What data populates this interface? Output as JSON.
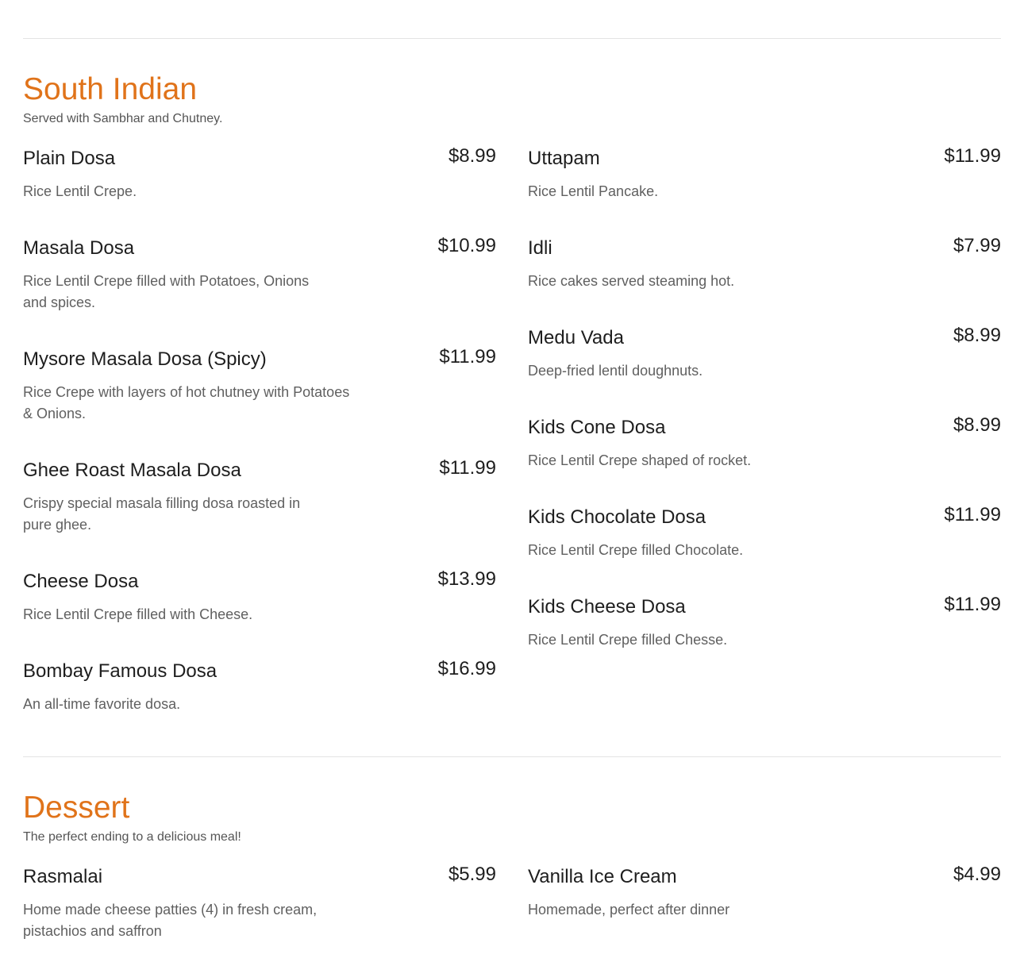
{
  "sections": [
    {
      "title": "South Indian",
      "subtitle": "Served with Sambhar and Chutney.",
      "left_items": [
        {
          "name": "Plain Dosa",
          "price": "$8.99",
          "desc": "Rice Lentil Crepe."
        },
        {
          "name": "Masala Dosa",
          "price": "$10.99",
          "desc": "Rice Lentil Crepe filled with Potatoes, Onions and spices."
        },
        {
          "name": "Mysore Masala Dosa (Spicy)",
          "price": "$11.99",
          "desc": "Rice Crepe with layers of hot chutney with Potatoes & Onions."
        },
        {
          "name": "Ghee Roast Masala Dosa",
          "price": "$11.99",
          "desc": "Crispy special masala filling dosa roasted in pure ghee."
        },
        {
          "name": "Cheese Dosa",
          "price": "$13.99",
          "desc": "Rice Lentil Crepe filled with Cheese."
        },
        {
          "name": "Bombay Famous Dosa",
          "price": "$16.99",
          "desc": "An all-time favorite dosa."
        }
      ],
      "right_items": [
        {
          "name": "Uttapam",
          "price": "$11.99",
          "desc": "Rice Lentil Pancake."
        },
        {
          "name": "Idli",
          "price": "$7.99",
          "desc": "Rice cakes served steaming hot."
        },
        {
          "name": "Medu Vada",
          "price": "$8.99",
          "desc": "Deep-fried lentil doughnuts."
        },
        {
          "name": "Kids Cone Dosa",
          "price": "$8.99",
          "desc": "Rice Lentil Crepe shaped of rocket."
        },
        {
          "name": "Kids Chocolate Dosa",
          "price": "$11.99",
          "desc": "Rice Lentil Crepe filled Chocolate."
        },
        {
          "name": "Kids Cheese Dosa",
          "price": "$11.99",
          "desc": "Rice Lentil Crepe filled Chesse."
        }
      ]
    },
    {
      "title": "Dessert",
      "subtitle": "The perfect ending to a delicious meal!",
      "left_items": [
        {
          "name": "Rasmalai",
          "price": "$5.99",
          "desc": "Home made cheese patties (4) in fresh cream, pistachios and saffron"
        }
      ],
      "right_items": [
        {
          "name": "Vanilla Ice Cream",
          "price": "$4.99",
          "desc": "Homemade, perfect after dinner"
        }
      ]
    }
  ],
  "accent_color": "#e0731a"
}
